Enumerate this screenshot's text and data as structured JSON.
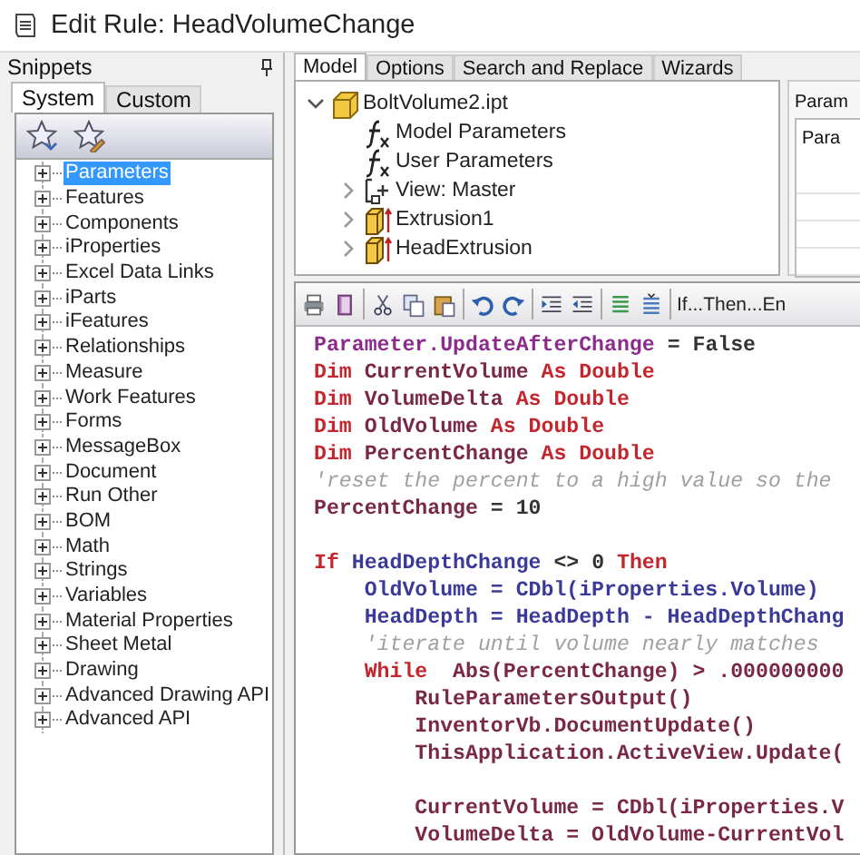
{
  "window": {
    "title": "Edit Rule: HeadVolumeChange"
  },
  "snippets": {
    "title": "Snippets",
    "tabs": [
      {
        "label": "System",
        "selected": true
      },
      {
        "label": "Custom",
        "selected": false
      }
    ],
    "items": [
      {
        "label": "Parameters",
        "selected": true,
        "expanded": false
      },
      {
        "label": "Features",
        "selected": false,
        "expanded": false
      },
      {
        "label": "Components",
        "selected": false,
        "expanded": false
      },
      {
        "label": "iProperties",
        "selected": false,
        "expanded": false
      },
      {
        "label": "Excel Data Links",
        "selected": false,
        "expanded": false
      },
      {
        "label": "iParts",
        "selected": false,
        "expanded": false
      },
      {
        "label": "iFeatures",
        "selected": false,
        "expanded": false
      },
      {
        "label": "Relationships",
        "selected": false,
        "expanded": false
      },
      {
        "label": "Measure",
        "selected": false,
        "expanded": false
      },
      {
        "label": "Work Features",
        "selected": false,
        "expanded": false
      },
      {
        "label": "Forms",
        "selected": false,
        "expanded": false
      },
      {
        "label": "MessageBox",
        "selected": false,
        "expanded": false
      },
      {
        "label": "Document",
        "selected": false,
        "expanded": false
      },
      {
        "label": "Run Other",
        "selected": false,
        "expanded": false
      },
      {
        "label": "BOM",
        "selected": false,
        "expanded": false
      },
      {
        "label": "Math",
        "selected": false,
        "expanded": false
      },
      {
        "label": "Strings",
        "selected": false,
        "expanded": false
      },
      {
        "label": "Variables",
        "selected": false,
        "expanded": false
      },
      {
        "label": "Material Properties",
        "selected": false,
        "expanded": false
      },
      {
        "label": "Sheet Metal",
        "selected": false,
        "expanded": false
      },
      {
        "label": "Drawing",
        "selected": false,
        "expanded": false
      },
      {
        "label": "Advanced Drawing API",
        "selected": false,
        "expanded": false
      },
      {
        "label": "Advanced API",
        "selected": false,
        "expanded": false
      }
    ]
  },
  "tabs": [
    {
      "label": "Model",
      "selected": true
    },
    {
      "label": "Options",
      "selected": false
    },
    {
      "label": "Search and Replace",
      "selected": false
    },
    {
      "label": "Wizards",
      "selected": false
    }
  ],
  "model_tree": [
    {
      "label": "BoltVolume2.ipt",
      "kind": "part",
      "expanded": true,
      "children": [
        {
          "label": "Model Parameters",
          "kind": "parameters"
        },
        {
          "label": "User Parameters",
          "kind": "parameters"
        },
        {
          "label": "View: Master",
          "kind": "view",
          "expanded": false
        },
        {
          "label": "Extrusion1",
          "kind": "feature",
          "expanded": false
        },
        {
          "label": "HeadExtrusion",
          "kind": "feature",
          "expanded": false
        }
      ]
    }
  ],
  "parameters_panel": {
    "title": "Param",
    "column_1": "Para"
  },
  "editor": {
    "toolbar_text": "If...Then...En",
    "lines": [
      {
        "tokens": [
          {
            "kind": "builtin",
            "text": "Parameter.UpdateAfterChange"
          },
          {
            "kind": "plain",
            "text": " = False"
          }
        ]
      },
      {
        "tokens": [
          {
            "kind": "keyword",
            "text": "Dim "
          },
          {
            "kind": "variable",
            "text": "CurrentVolume "
          },
          {
            "kind": "keyword",
            "text": "As Double"
          }
        ]
      },
      {
        "tokens": [
          {
            "kind": "keyword",
            "text": "Dim "
          },
          {
            "kind": "variable",
            "text": "VolumeDelta "
          },
          {
            "kind": "keyword",
            "text": "As Double"
          }
        ]
      },
      {
        "tokens": [
          {
            "kind": "keyword",
            "text": "Dim "
          },
          {
            "kind": "variable",
            "text": "OldVolume "
          },
          {
            "kind": "keyword",
            "text": "As Double"
          }
        ]
      },
      {
        "tokens": [
          {
            "kind": "keyword",
            "text": "Dim "
          },
          {
            "kind": "variable",
            "text": "PercentChange "
          },
          {
            "kind": "keyword",
            "text": "As Double"
          }
        ]
      },
      {
        "tokens": [
          {
            "kind": "comment",
            "text": "'reset the percent to a high value so the"
          }
        ]
      },
      {
        "tokens": [
          {
            "kind": "variable",
            "text": "PercentChange"
          },
          {
            "kind": "plain",
            "text": " = 10"
          }
        ]
      },
      {
        "gap_before": true,
        "tokens": [
          {
            "kind": "keyword",
            "text": "If "
          },
          {
            "kind": "parameter",
            "text": "HeadDepthChange"
          },
          {
            "kind": "plain",
            "text": " <> 0 "
          },
          {
            "kind": "keyword",
            "text": "Then"
          }
        ]
      },
      {
        "tokens": [
          {
            "kind": "parameter",
            "text": "    OldVolume = CDbl(iProperties.Volume)"
          }
        ]
      },
      {
        "tokens": [
          {
            "kind": "parameter",
            "text": "    HeadDepth = HeadDepth - HeadDepthChang"
          }
        ]
      },
      {
        "tokens": [
          {
            "kind": "comment",
            "text": "    'iterate until volume nearly matches"
          }
        ]
      },
      {
        "tokens": [
          {
            "kind": "keyword",
            "text": "    While "
          },
          {
            "kind": "variable",
            "text": " Abs(PercentChange) > .000000000"
          }
        ]
      },
      {
        "tokens": [
          {
            "kind": "variable",
            "text": "        RuleParametersOutput()"
          }
        ]
      },
      {
        "tokens": [
          {
            "kind": "variable",
            "text": "        InventorVb.DocumentUpdate()"
          }
        ]
      },
      {
        "tokens": [
          {
            "kind": "variable",
            "text": "        ThisApplication.ActiveView.Update("
          }
        ]
      },
      {
        "gap_before": true,
        "tokens": [
          {
            "kind": "variable",
            "text": "        CurrentVolume = CDbl(iProperties.V"
          }
        ]
      },
      {
        "tokens": [
          {
            "kind": "variable",
            "text": "        VolumeDelta = OldVolume-CurrentVol"
          }
        ]
      }
    ]
  }
}
